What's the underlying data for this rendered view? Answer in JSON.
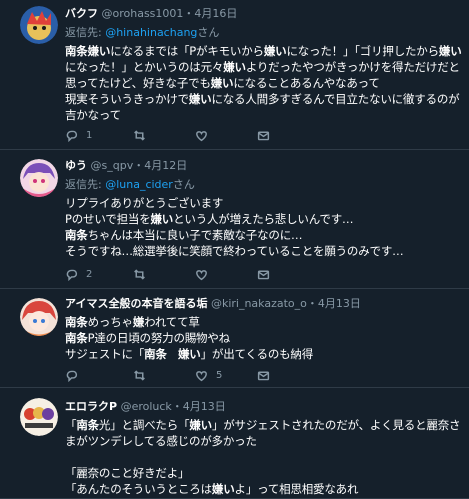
{
  "tweets": [
    {
      "display_name": "バクフ",
      "handle": "@orohass1001",
      "separator": "・",
      "date": "4月16日",
      "reply_prefix": "返信先: ",
      "reply_handle": "@hinahinachang",
      "reply_suffix": "さん",
      "text_segments": [
        {
          "t": "南条嫌い",
          "b": true
        },
        {
          "t": "になるまでは「Pがキモいから",
          "b": false
        },
        {
          "t": "嫌い",
          "b": true
        },
        {
          "t": "になった！」「ゴリ押したから",
          "b": false
        },
        {
          "t": "嫌い",
          "b": true
        },
        {
          "t": "になった！」とかいうのは元々",
          "b": false
        },
        {
          "t": "嫌い",
          "b": true
        },
        {
          "t": "よりだったやつがきっかけを得ただけだと思ってたけど、好きな子でも",
          "b": false
        },
        {
          "t": "嫌い",
          "b": true
        },
        {
          "t": "になることあるんやなあって\n現実そういうきっかけで",
          "b": false
        },
        {
          "t": "嫌い",
          "b": true
        },
        {
          "t": "になる人間多すぎるんで目立たないに徹するのが吉かなって",
          "b": false
        }
      ],
      "reply_count": "1",
      "retweet_count": "",
      "like_count": ""
    },
    {
      "display_name": "ゆう",
      "handle": "@s_qpv",
      "separator": "・",
      "date": "4月12日",
      "reply_prefix": "返信先: ",
      "reply_handle": "@luna_cider",
      "reply_suffix": "さん",
      "text_segments": [
        {
          "t": "リプライありがとうございます\nPのせいで担当を",
          "b": false
        },
        {
          "t": "嫌い",
          "b": true
        },
        {
          "t": "という人が増えたら悲しいんです…\n",
          "b": false
        },
        {
          "t": "南条",
          "b": true
        },
        {
          "t": "ちゃんは本当に良い子で素敵な子なのに…\nそうですね…総選挙後に笑顔で終わっていることを願うのみです…",
          "b": false
        }
      ],
      "reply_count": "2",
      "retweet_count": "",
      "like_count": ""
    },
    {
      "display_name": "アイマス全般の本音を語る垢",
      "handle": "@kiri_nakazato_o",
      "separator": "・",
      "date": "4月13日",
      "text_segments": [
        {
          "t": "南条",
          "b": true
        },
        {
          "t": "めっちゃ",
          "b": false
        },
        {
          "t": "嫌",
          "b": true
        },
        {
          "t": "われてて草\n",
          "b": false
        },
        {
          "t": "南条",
          "b": true
        },
        {
          "t": "P達の日頃の努力の賜物やね\nサジェストに「",
          "b": false
        },
        {
          "t": "南条　嫌い",
          "b": true
        },
        {
          "t": "」が出てくるのも納得",
          "b": false
        }
      ],
      "reply_count": "",
      "retweet_count": "",
      "like_count": "5"
    },
    {
      "display_name": "エロラクP",
      "handle": "@eroluck",
      "separator": "・",
      "date": "4月13日",
      "text_segments": [
        {
          "t": "「",
          "b": false
        },
        {
          "t": "南条",
          "b": true
        },
        {
          "t": "光」と調べたら「",
          "b": false
        },
        {
          "t": "嫌い",
          "b": true
        },
        {
          "t": "」がサジェストされたのだが、よく見ると麗奈さまがツンデレしてる感じのが多かった\n\n「麗奈のこと好きだよ」\n「あんたのそういうところは",
          "b": false
        },
        {
          "t": "嫌い",
          "b": true
        },
        {
          "t": "よ」って相思相愛なあれ",
          "b": false
        }
      ]
    }
  ],
  "icons": {
    "reply": "reply-icon",
    "retweet": "retweet-icon",
    "like": "heart-icon",
    "message": "envelope-icon"
  },
  "colors": {
    "background": "#15202b",
    "accent": "#1da1f2",
    "muted": "#8899a6",
    "divider": "#2f3b47"
  }
}
